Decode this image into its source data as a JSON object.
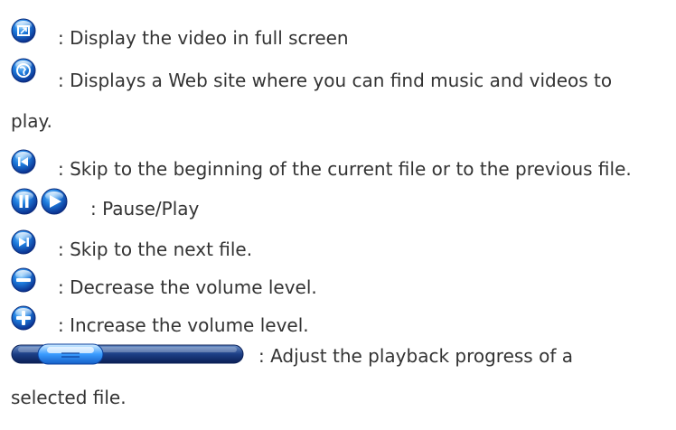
{
  "items": [
    {
      "icon": "fullscreen-icon",
      "text": ": Display the video in full screen"
    },
    {
      "icon": "web-globe-icon",
      "text": ": Displays a Web site where you can find music and videos to",
      "text2": "play."
    },
    {
      "icon": "skip-previous-icon",
      "text": ": Skip to the beginning of the current file or to the previous file."
    },
    {
      "icon": "pause-play-icon",
      "text": ": Pause/Play"
    },
    {
      "icon": "skip-next-icon",
      "text": ": Skip to the next file."
    },
    {
      "icon": "volume-decrease-icon",
      "text": ": Decrease the volume level."
    },
    {
      "icon": "volume-increase-icon",
      "text": ": Increase the volume level."
    },
    {
      "icon": "progress-slider-icon",
      "text": ": Adjust the playback progress of a",
      "text2": "selected file."
    }
  ]
}
